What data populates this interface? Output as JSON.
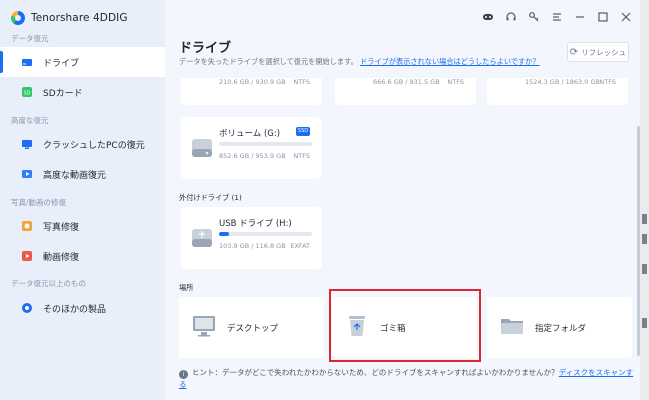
{
  "app": {
    "name": "Tenorshare 4DDIG"
  },
  "sidebar": {
    "sections": [
      {
        "label": "データ復元"
      },
      {
        "label": "高度な復元"
      },
      {
        "label": "写真/動画の修復"
      },
      {
        "label": "データ復元以上のもの"
      }
    ],
    "items": [
      {
        "label": "ドライブ",
        "active": true
      },
      {
        "label": "SDカード"
      },
      {
        "label": "クラッシュしたPCの復元"
      },
      {
        "label": "高度な動画復元"
      },
      {
        "label": "写真修復"
      },
      {
        "label": "動画修復"
      },
      {
        "label": "そのほかの製品"
      }
    ]
  },
  "header": {
    "title": "ドライブ",
    "subtitle": "データを失ったドライブを選択して復元を開始します。",
    "subtitle_link": "ドライブが表示されない場合はどうしたらよいですか？",
    "refresh_label": "リフレッシュ"
  },
  "drives": {
    "top_row": [
      {
        "size": "210.6 GB / 930.9 GB",
        "fs": "NTFS"
      },
      {
        "size": "666.6 GB / 931.5 GB",
        "fs": "NTFS"
      },
      {
        "size": "1524.3 GB / 1863.0 GB",
        "fs": "NTFS"
      }
    ],
    "volume_g": {
      "name": "ボリューム (G:)",
      "badge": "SSD",
      "size": "852.6 GB / 953.9 GB",
      "fs": "NTFS",
      "used_fraction": 0.0
    },
    "external_label": "外付けドライブ (1)",
    "usb": {
      "name": "USB ドライブ (H:)",
      "size": "103.9 GB / 116.8 GB",
      "fs": "EXFAT",
      "used_fraction": 0.11
    }
  },
  "locations": {
    "label": "場所",
    "items": [
      {
        "label": "デスクトップ"
      },
      {
        "label": "ゴミ箱"
      },
      {
        "label": "指定フォルダ"
      }
    ]
  },
  "hint": {
    "prefix": "ヒント：データがどこで失われたかわからないため、どのドライブをスキャンすればよいかわかりませんか？",
    "link": "ディスクをスキャンする"
  },
  "colors": {
    "accent": "#1a6ef5",
    "highlight": "#e0252f"
  }
}
